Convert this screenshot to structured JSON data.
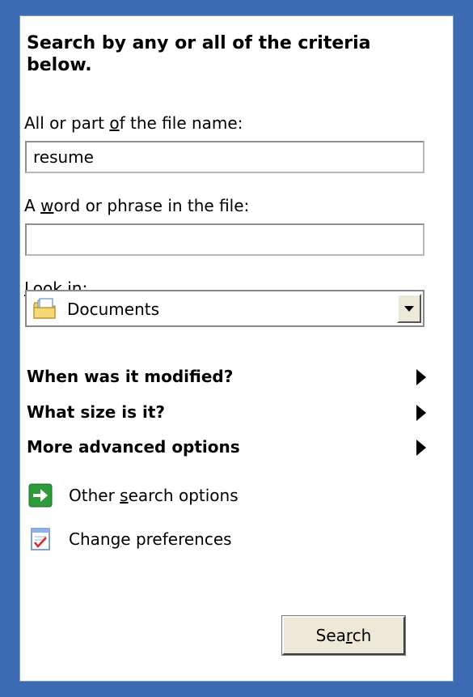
{
  "heading": "Search by any or all of the criteria below.",
  "filename": {
    "label_pre": "All or part ",
    "label_accel": "o",
    "label_post": "f the file name:",
    "value": "resume"
  },
  "phrase": {
    "label_pre": "A ",
    "label_accel": "w",
    "label_post": "ord or phrase in the file:",
    "value": ""
  },
  "lookin": {
    "label_accel": "L",
    "label_post": "ook in:",
    "selected": "Documents",
    "icon": "documents-folder-icon"
  },
  "options": [
    {
      "label": "When was it modified?",
      "icon": "expand-arrow-icon"
    },
    {
      "label": "What size is it?",
      "icon": "expand-arrow-icon"
    },
    {
      "label": "More advanced options",
      "icon": "expand-arrow-icon"
    }
  ],
  "links": [
    {
      "pre": "Other ",
      "accel": "s",
      "post": "earch options",
      "icon": "green-arrow-icon"
    },
    {
      "pre": "Chan",
      "accel": "g",
      "post": "e preferences",
      "icon": "preferences-icon"
    }
  ],
  "search_button": {
    "pre": "Sea",
    "accel": "r",
    "post": "ch"
  },
  "colors": {
    "background": "#3d6bb3",
    "panel": "#ffffff",
    "button_face": "#ece9d8"
  }
}
